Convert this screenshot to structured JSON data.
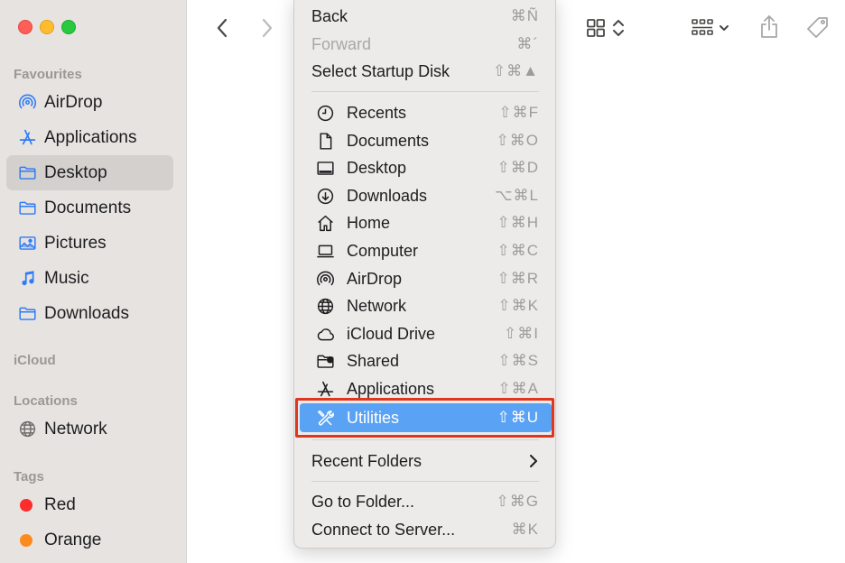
{
  "sidebar": {
    "favourites_label": "Favourites",
    "favourites": [
      {
        "label": "AirDrop",
        "icon": "airdrop-icon"
      },
      {
        "label": "Applications",
        "icon": "applications-icon"
      },
      {
        "label": "Desktop",
        "icon": "folder-icon",
        "selected": true
      },
      {
        "label": "Documents",
        "icon": "folder-icon"
      },
      {
        "label": "Pictures",
        "icon": "pictures-icon"
      },
      {
        "label": "Music",
        "icon": "music-icon"
      },
      {
        "label": "Downloads",
        "icon": "folder-icon"
      }
    ],
    "icloud_label": "iCloud",
    "locations_label": "Locations",
    "locations": [
      {
        "label": "Network",
        "icon": "network-icon"
      }
    ],
    "tags_label": "Tags",
    "tags": [
      {
        "label": "Red",
        "color": "#fe2c2a"
      },
      {
        "label": "Orange",
        "color": "#fd8a1e"
      }
    ]
  },
  "colors": {
    "accent": "#5aa2f3",
    "sidebar_icon": "#2f7bf5",
    "highlight_border": "#e0351f"
  },
  "menu": {
    "top_items": [
      {
        "label": "Back",
        "shortcut": "⌘Ñ",
        "disabled": false
      },
      {
        "label": "Forward",
        "shortcut": "⌘´",
        "disabled": true
      },
      {
        "label": "Select Startup Disk",
        "shortcut": "⇧⌘▲",
        "disabled": false
      }
    ],
    "places": [
      {
        "label": "Recents",
        "shortcut": "⇧⌘F",
        "icon": "clock-icon"
      },
      {
        "label": "Documents",
        "shortcut": "⇧⌘O",
        "icon": "document-icon"
      },
      {
        "label": "Desktop",
        "shortcut": "⇧⌘D",
        "icon": "desktop-icon"
      },
      {
        "label": "Downloads",
        "shortcut": "⌥⌘L",
        "icon": "download-icon"
      },
      {
        "label": "Home",
        "shortcut": "⇧⌘H",
        "icon": "home-icon"
      },
      {
        "label": "Computer",
        "shortcut": "⇧⌘C",
        "icon": "laptop-icon"
      },
      {
        "label": "AirDrop",
        "shortcut": "⇧⌘R",
        "icon": "airdrop-icon"
      },
      {
        "label": "Network",
        "shortcut": "⇧⌘K",
        "icon": "globe-icon"
      },
      {
        "label": "iCloud Drive",
        "shortcut": "⇧⌘I",
        "icon": "cloud-icon"
      },
      {
        "label": "Shared",
        "shortcut": "⇧⌘S",
        "icon": "shared-folder-icon"
      },
      {
        "label": "Applications",
        "shortcut": "⇧⌘A",
        "icon": "applications-icon"
      },
      {
        "label": "Utilities",
        "shortcut": "⇧⌘U",
        "icon": "utilities-icon",
        "highlighted": true
      }
    ],
    "recent_folders": "Recent Folders",
    "bottom_items": [
      {
        "label": "Go to Folder...",
        "shortcut": "⇧⌘G"
      },
      {
        "label": "Connect to Server...",
        "shortcut": "⌘K"
      }
    ]
  }
}
